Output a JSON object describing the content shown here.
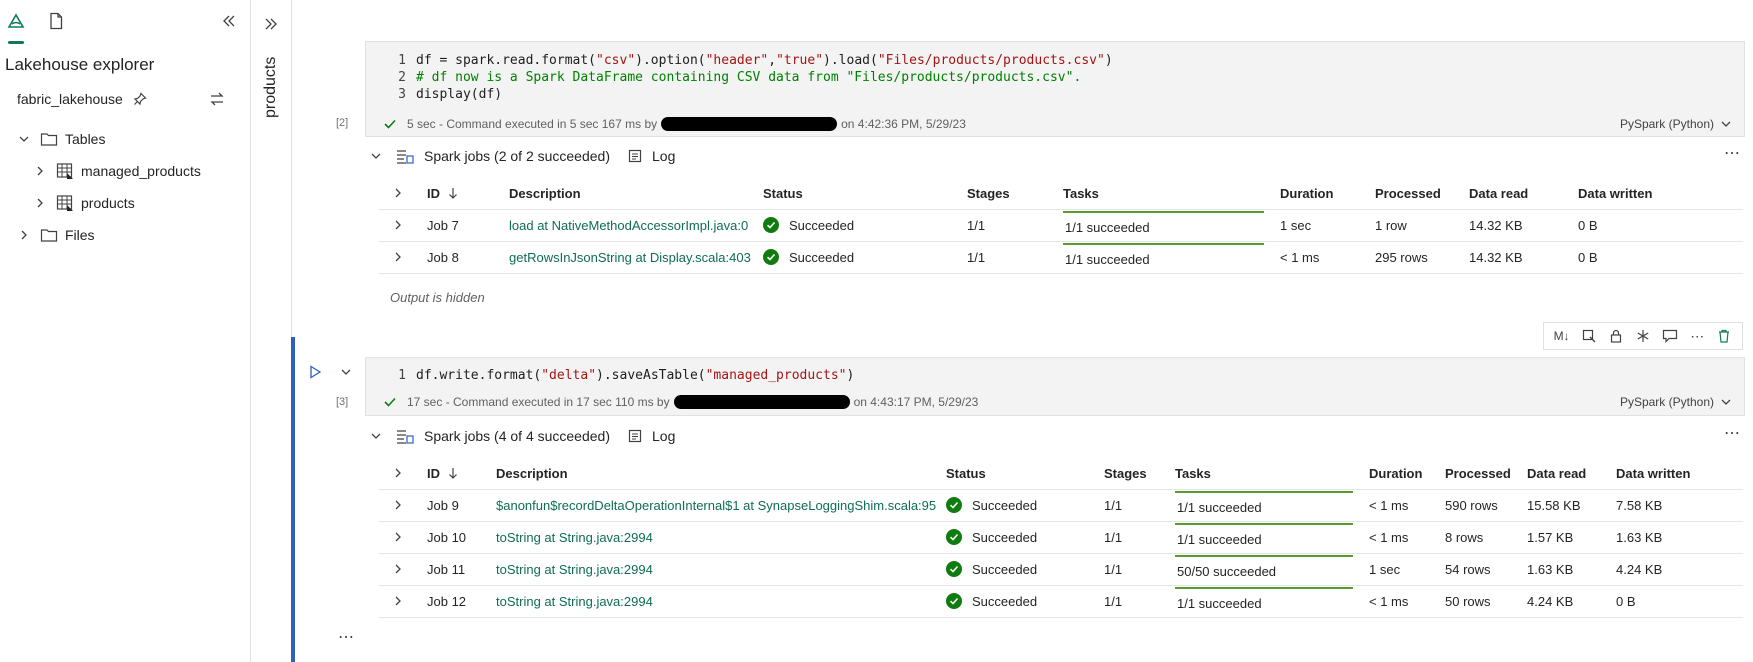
{
  "explorer": {
    "title": "Lakehouse explorer",
    "lakehouse_name": "fabric_lakehouse",
    "tree": {
      "tables_label": "Tables",
      "table_items": [
        "managed_products",
        "products"
      ],
      "files_label": "Files"
    }
  },
  "sidebar": {
    "title": "products"
  },
  "cell1": {
    "exec_count": "[2]",
    "lines": [
      {
        "num": "1",
        "parts": [
          {
            "t": "df = spark.read.format(",
            "c": "code"
          },
          {
            "t": "\"csv\"",
            "c": "str"
          },
          {
            "t": ").option(",
            "c": "code"
          },
          {
            "t": "\"header\"",
            "c": "str"
          },
          {
            "t": ",",
            "c": "code"
          },
          {
            "t": "\"true\"",
            "c": "str"
          },
          {
            "t": ").load(",
            "c": "code"
          },
          {
            "t": "\"Files/products/products.csv\"",
            "c": "str"
          },
          {
            "t": ")",
            "c": "code"
          }
        ]
      },
      {
        "num": "2",
        "parts": [
          {
            "t": "# df now is a Spark DataFrame containing CSV data from \"Files/products/products.csv\".",
            "c": "cmt"
          }
        ]
      },
      {
        "num": "3",
        "parts": [
          {
            "t": "display(df)",
            "c": "code"
          }
        ]
      }
    ],
    "status_prefix": "5 sec - Command executed in 5 sec 167 ms by",
    "status_suffix": "on 4:42:36 PM, 5/29/23",
    "language": "PySpark (Python)"
  },
  "jobs1": {
    "title": "Spark jobs (2 of 2 succeeded)",
    "log_label": "Log",
    "columns": [
      "ID",
      "Description",
      "Status",
      "Stages",
      "Tasks",
      "Duration",
      "Processed",
      "Data read",
      "Data written"
    ],
    "rows": [
      {
        "id": "Job 7",
        "desc": "load at NativeMethodAccessorImpl.java:0",
        "status": "Succeeded",
        "stages": "1/1",
        "tasks": "1/1 succeeded",
        "duration": "1 sec",
        "processed": "1 row",
        "read": "14.32 KB",
        "written": "0 B"
      },
      {
        "id": "Job 8",
        "desc": "getRowsInJsonString at Display.scala:403",
        "status": "Succeeded",
        "stages": "1/1",
        "tasks": "1/1 succeeded",
        "duration": "< 1 ms",
        "processed": "295 rows",
        "read": "14.32 KB",
        "written": "0 B"
      }
    ],
    "output_hidden": "Output is hidden"
  },
  "cell2": {
    "exec_count": "[3]",
    "lines": [
      {
        "num": "1",
        "parts": [
          {
            "t": "df.write.format(",
            "c": "code"
          },
          {
            "t": "\"delta\"",
            "c": "str"
          },
          {
            "t": ").saveAsTable(",
            "c": "code"
          },
          {
            "t": "\"managed_products\"",
            "c": "str"
          },
          {
            "t": ")",
            "c": "code"
          }
        ]
      }
    ],
    "status_prefix": "17 sec - Command executed in 17 sec 110 ms by",
    "status_suffix": "on 4:43:17 PM, 5/29/23",
    "language": "PySpark (Python)",
    "toolbar_md": "M↓"
  },
  "jobs2": {
    "title": "Spark jobs (4 of 4 succeeded)",
    "log_label": "Log",
    "columns": [
      "ID",
      "Description",
      "Status",
      "Stages",
      "Tasks",
      "Duration",
      "Processed",
      "Data read",
      "Data written"
    ],
    "rows": [
      {
        "id": "Job 9",
        "desc": "$anonfun$recordDeltaOperationInternal$1 at SynapseLoggingShim.scala:95",
        "status": "Succeeded",
        "stages": "1/1",
        "tasks": "1/1 succeeded",
        "duration": "< 1 ms",
        "processed": "590 rows",
        "read": "15.58 KB",
        "written": "7.58 KB"
      },
      {
        "id": "Job 10",
        "desc": "toString at String.java:2994",
        "status": "Succeeded",
        "stages": "1/1",
        "tasks": "1/1 succeeded",
        "duration": "< 1 ms",
        "processed": "8 rows",
        "read": "1.57 KB",
        "written": "1.63 KB"
      },
      {
        "id": "Job 11",
        "desc": "toString at String.java:2994",
        "status": "Succeeded",
        "stages": "1/1",
        "tasks": "50/50 succeeded",
        "duration": "1 sec",
        "processed": "54 rows",
        "read": "1.63 KB",
        "written": "4.24 KB"
      },
      {
        "id": "Job 12",
        "desc": "toString at String.java:2994",
        "status": "Succeeded",
        "stages": "1/1",
        "tasks": "1/1 succeeded",
        "duration": "< 1 ms",
        "processed": "50 rows",
        "read": "4.24 KB",
        "written": "0 B"
      }
    ]
  },
  "colors": {
    "accent": "#0f7a5a",
    "active_rail": "#2f5fbf",
    "success": "#107c10",
    "task_bar": "#5a9a2b",
    "link": "#0f6d55"
  }
}
